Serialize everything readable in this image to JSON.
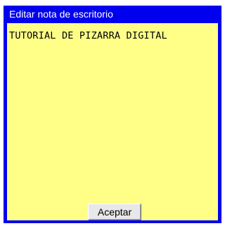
{
  "window": {
    "title": "Editar nota de escritorio"
  },
  "note": {
    "text": "TUTORIAL DE PIZARRA DIGITAL"
  },
  "buttons": {
    "ok_label": "Aceptar"
  },
  "colors": {
    "frame": "#0000ee",
    "note_background": "#ffff88",
    "title_text": "#ffffff"
  }
}
